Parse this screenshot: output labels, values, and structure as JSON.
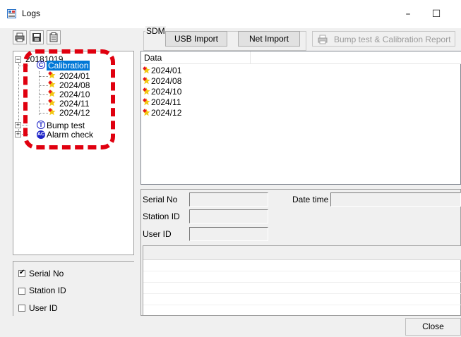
{
  "window": {
    "title": "Logs",
    "controls": [
      "–",
      "☐",
      "✕"
    ]
  },
  "toolbar": {
    "print_icon": "printer-icon",
    "save_icon": "floppy-disk-icon",
    "clipboard_icon": "clipboard-icon"
  },
  "sdm": {
    "group_label": "SDM",
    "usb_import": "USB Import",
    "net_import": "Net Import"
  },
  "report_button": "Bump test & Calibration Report",
  "tree": {
    "root_label": "20181019",
    "calibration": {
      "badge": "C",
      "label": "Calibration",
      "selected": true
    },
    "calibration_children": [
      "2024/01",
      "2024/08",
      "2024/10",
      "2024/11",
      "2024/12"
    ],
    "bump_test": {
      "badge": "T",
      "label": "Bump test"
    },
    "alarm_check": {
      "badge": "AC",
      "label": "Alarm check"
    },
    "expander_collapsed": "+",
    "expander_expanded": "−"
  },
  "checkboxes": [
    {
      "label": "Serial No",
      "checked": true
    },
    {
      "label": "Station ID",
      "checked": false
    },
    {
      "label": "User ID",
      "checked": false
    }
  ],
  "data_list": {
    "header": "Data",
    "rows": [
      "2024/01",
      "2024/08",
      "2024/10",
      "2024/11",
      "2024/12"
    ]
  },
  "info": {
    "serial_no_label": "Serial No",
    "date_time_label": "Date time",
    "station_id_label": "Station ID",
    "user_id_label": "User ID",
    "serial_no_value": "",
    "date_time_value": "",
    "station_id_value": "",
    "user_id_value": ""
  },
  "close_button": "Close",
  "colors": {
    "selection": "#0078d7",
    "badge_blue": "#1e24c8",
    "annotation_red": "#e0000f",
    "diamond_red": "#e8141e",
    "star_yellow": "#f2c811"
  }
}
